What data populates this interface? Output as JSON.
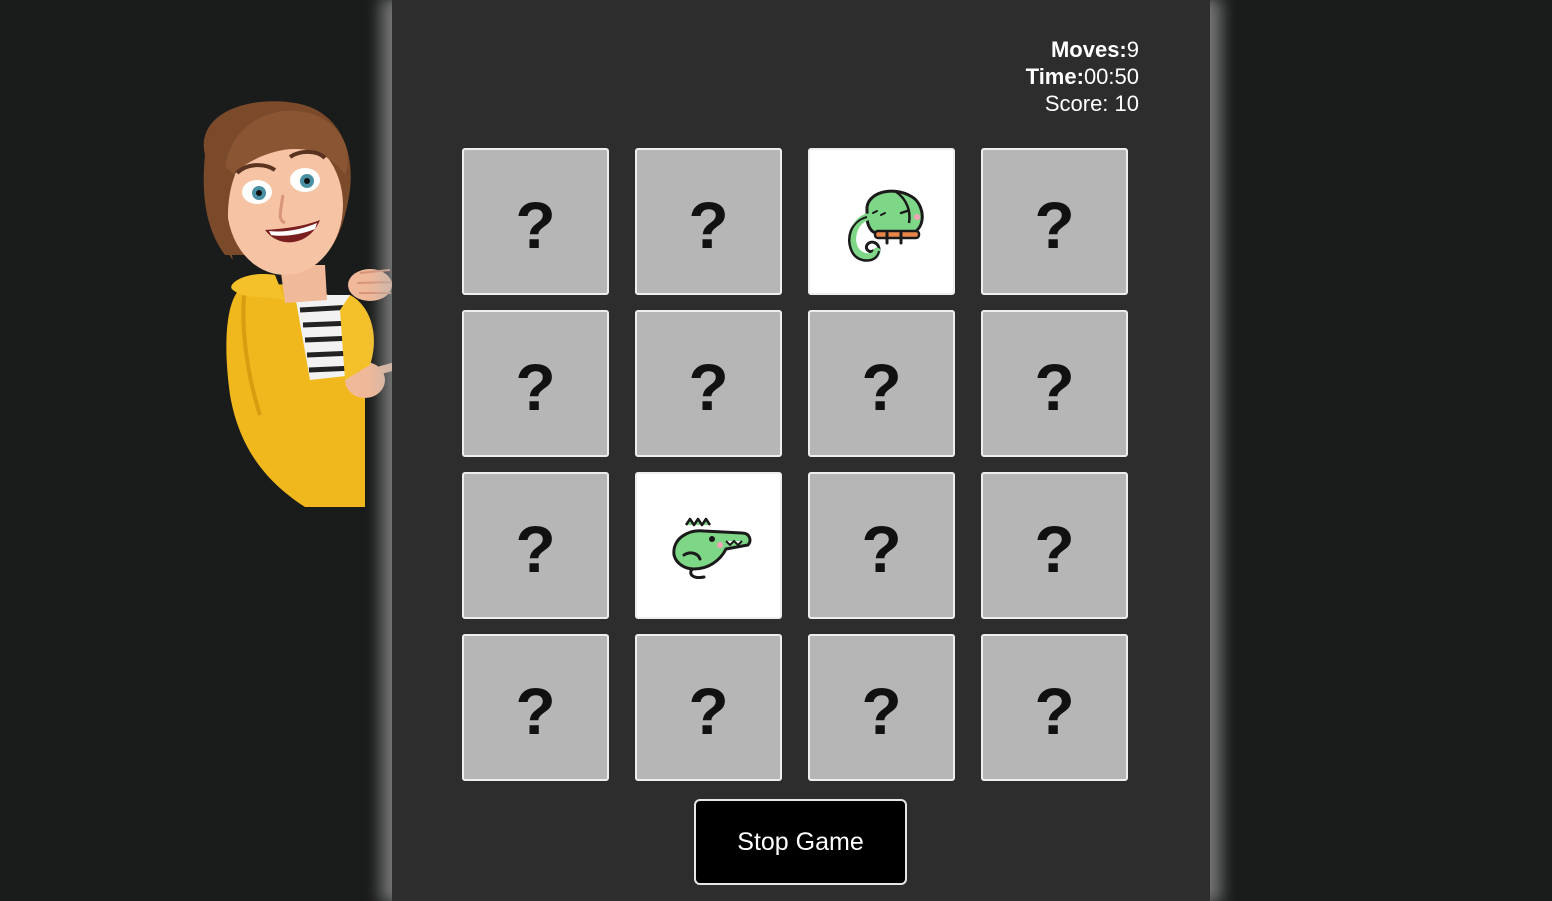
{
  "stats": {
    "moves_label": "Moves:",
    "moves_value": "9",
    "time_label": "Time:",
    "time_value": "00:50",
    "score_text": "Score: 10"
  },
  "board": {
    "hidden_symbol": "?",
    "cards": [
      {
        "state": "hidden"
      },
      {
        "state": "hidden"
      },
      {
        "state": "revealed",
        "icon": "chameleon-icon"
      },
      {
        "state": "hidden"
      },
      {
        "state": "hidden"
      },
      {
        "state": "hidden"
      },
      {
        "state": "hidden"
      },
      {
        "state": "hidden"
      },
      {
        "state": "hidden"
      },
      {
        "state": "revealed",
        "icon": "crocodile-icon"
      },
      {
        "state": "hidden"
      },
      {
        "state": "hidden"
      },
      {
        "state": "hidden"
      },
      {
        "state": "hidden"
      },
      {
        "state": "hidden"
      },
      {
        "state": "hidden"
      }
    ]
  },
  "controls": {
    "stop_label": "Stop Game"
  },
  "colors": {
    "background": "#1a1b1b",
    "panel": "#2d2d2d",
    "card_hidden": "#b5b6b5",
    "card_revealed": "#ffffff",
    "animal_green": "#7ed687",
    "button": "#000000"
  },
  "mascot": {
    "icon": "cartoon-woman-mascot-icon"
  }
}
